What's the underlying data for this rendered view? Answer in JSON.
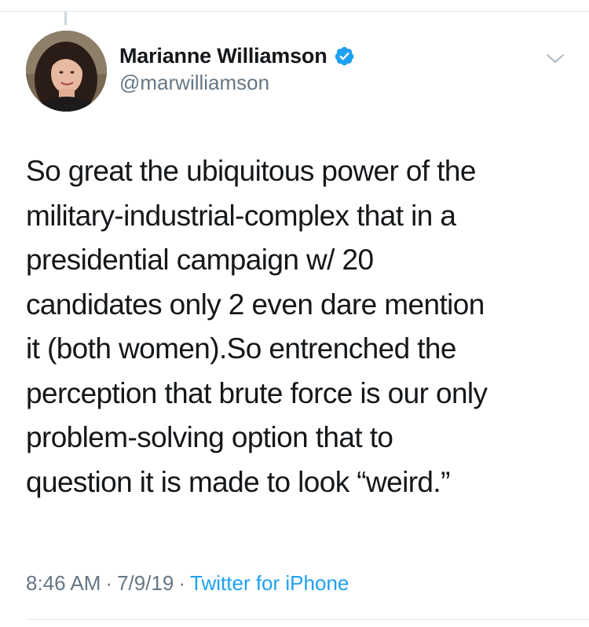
{
  "tweet": {
    "author": {
      "display_name": "Marianne Williamson",
      "handle": "@marwilliamson",
      "verified": true,
      "avatar_icon": "profile-photo"
    },
    "text": "So great the ubiquitous power of the\nmilitary-industrial-complex that in a\npresidential campaign w/ 20\ncandidates only 2 even dare mention\nit (both women).So entrenched the\nperception that brute force is our only\nproblem-solving option that to\nquestion it is made to look “weird.”",
    "time": "8:46 AM",
    "separator": "·",
    "date": "7/9/19",
    "source": "Twitter for iPhone"
  },
  "icons": {
    "verified": "verified-badge-icon",
    "menu": "chevron-down-icon"
  },
  "colors": {
    "accent": "#1da1f2",
    "text": "#14171a",
    "secondary": "#657786",
    "border": "#e1e8ed"
  }
}
